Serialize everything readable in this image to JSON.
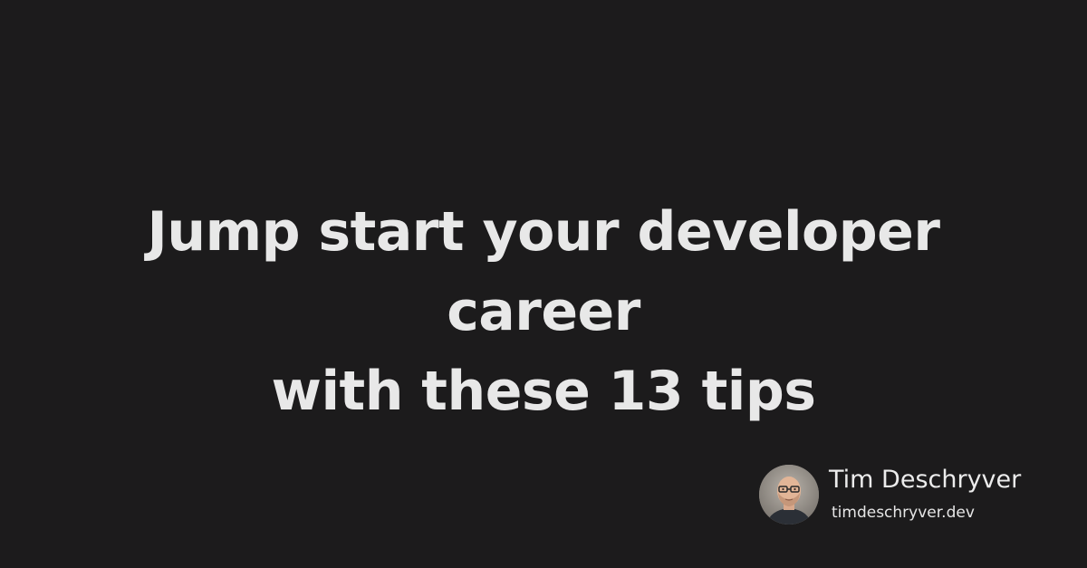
{
  "headline": {
    "line1": "Jump start your developer career",
    "line2": "with these 13 tips"
  },
  "author": {
    "name": "Tim Deschryver",
    "website": "timdeschryver.dev",
    "avatar_icon": "person-photo-icon"
  },
  "colors": {
    "background": "#1c1b1c",
    "text": "#e8e8e8"
  }
}
